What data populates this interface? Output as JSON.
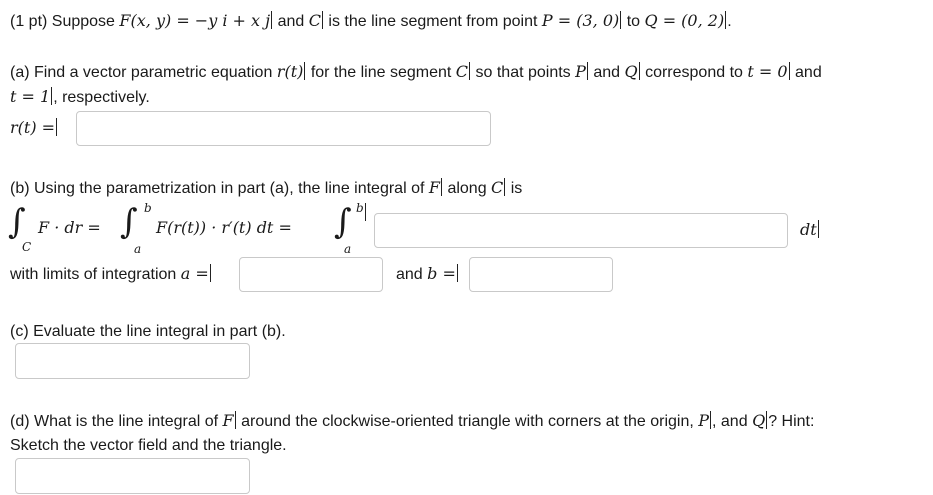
{
  "problem": {
    "intro_prefix": "(1 pt) Suppose",
    "intro_field": "F(x, y) = −y i + x j",
    "intro_and": "and",
    "intro_C": "C",
    "intro_segment": "is the line segment from point",
    "intro_P": "P = (3, 0)",
    "intro_to": "to",
    "intro_Q": "Q = (0, 2)",
    "intro_end": "."
  },
  "part_a": {
    "text_prefix": "(a) Find a vector parametric equation",
    "text_r": "r(t)",
    "text_mid": "for the line segment",
    "text_C": "C",
    "text_so": "so that points",
    "text_P": "P",
    "text_and": "and",
    "text_Q": "Q",
    "text_corr": "correspond to",
    "text_t0": "t = 0",
    "text_and2": "and",
    "text_t1": "t = 1",
    "text_resp": ", respectively.",
    "answer_label": "r(t) =",
    "answer_value": ""
  },
  "part_b": {
    "text_prefix": "(b) Using the parametrization in part (a), the line integral of",
    "text_F": "F",
    "text_along": "along",
    "text_C": "C",
    "text_is": "is",
    "integrand_lhs": "F · dr =",
    "integrand_mid": "F(r(t)) · r′(t) dt =",
    "sub_C": "C",
    "sup_b": "b",
    "sub_a": "a",
    "answer_value": "",
    "dt_label": "dt",
    "limits_label": "with limits of integration",
    "a_label": "a =",
    "a_value": "",
    "b_and": "and",
    "b_label": "b =",
    "b_value": ""
  },
  "part_c": {
    "text": "(c) Evaluate the line integral in part (b).",
    "answer_value": ""
  },
  "part_d": {
    "text_prefix": "(d) What is the line integral of",
    "text_F": "F",
    "text_mid": "around the clockwise-oriented triangle with corners at the origin,",
    "text_P": "P",
    "text_comma": ", and",
    "text_Q": "Q",
    "text_hint": "? Hint:",
    "text_line2": "Sketch the vector field and the triangle.",
    "answer_value": ""
  }
}
